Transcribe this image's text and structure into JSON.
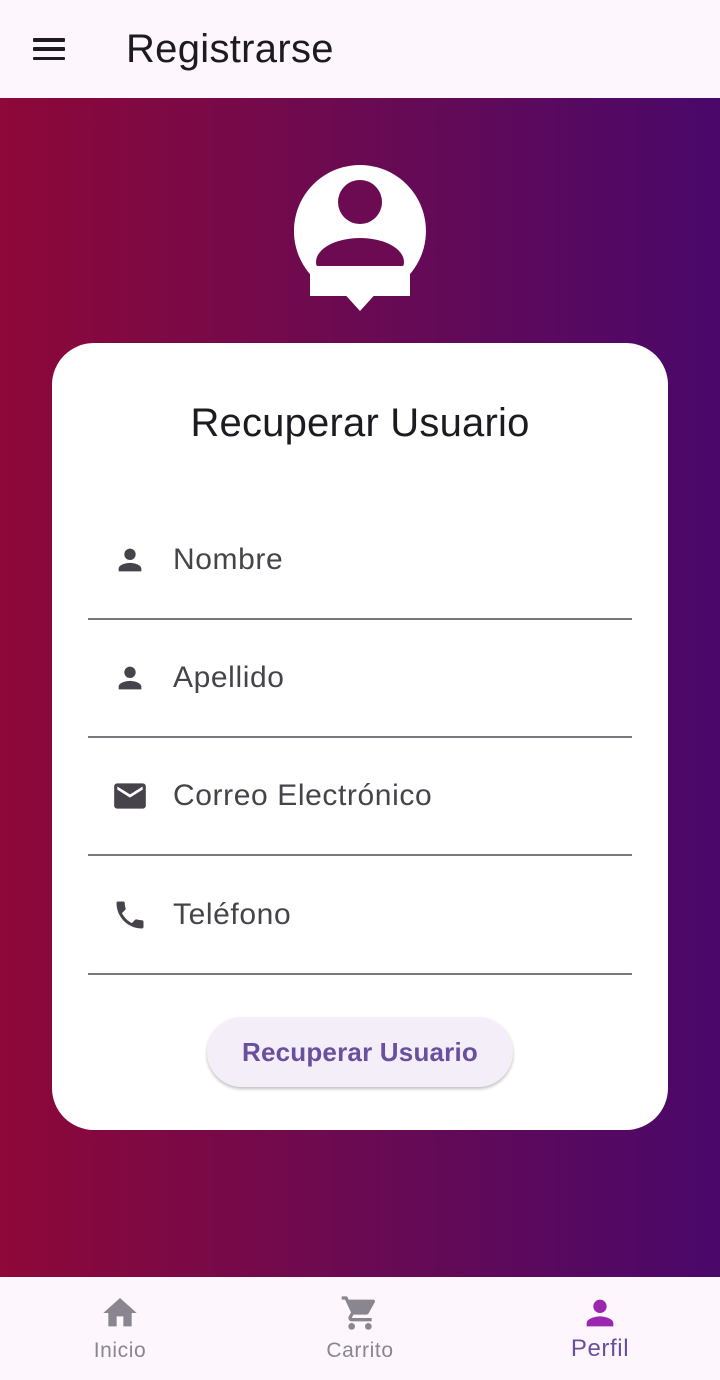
{
  "appbar": {
    "title": "Registrarse",
    "menu_icon": "menu-icon"
  },
  "colors": {
    "gradient_start": "#8e0838",
    "gradient_end": "#4a086a",
    "accent": "#6a4f9f",
    "active_icon": "#9b27b0"
  },
  "card": {
    "title": "Recuperar Usuario",
    "fields": [
      {
        "label": "Nombre",
        "icon": "person-icon"
      },
      {
        "label": "Apellido",
        "icon": "person-icon"
      },
      {
        "label": "Correo Electrónico",
        "icon": "mail-icon"
      },
      {
        "label": "Teléfono",
        "icon": "phone-icon"
      }
    ],
    "button_label": "Recuperar Usuario"
  },
  "bottom_nav": {
    "items": [
      {
        "label": "Inicio",
        "icon": "home-icon",
        "active": false
      },
      {
        "label": "Carrito",
        "icon": "cart-icon",
        "active": false
      },
      {
        "label": "Perfil",
        "icon": "person-icon",
        "active": true
      }
    ]
  }
}
